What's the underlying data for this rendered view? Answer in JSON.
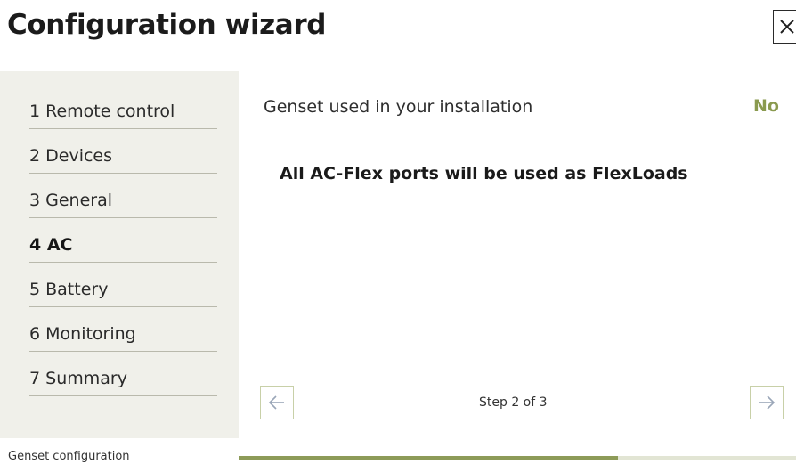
{
  "header": {
    "title": "Configuration wizard",
    "close_icon": "close-icon"
  },
  "sidebar": {
    "items": [
      {
        "label": "1 Remote control",
        "active": false
      },
      {
        "label": "2 Devices",
        "active": false
      },
      {
        "label": "3 General",
        "active": false
      },
      {
        "label": "4 AC",
        "active": true
      },
      {
        "label": "5 Battery",
        "active": false
      },
      {
        "label": "6 Monitoring",
        "active": false
      },
      {
        "label": "7 Summary",
        "active": false
      }
    ]
  },
  "main": {
    "genset_label": "Genset used in your installation",
    "genset_value": "No",
    "info_text": "All AC-Flex ports will be used as FlexLoads",
    "step_text": "Step 2 of 3",
    "prev_icon": "arrow-left-icon",
    "next_icon": "arrow-right-icon"
  },
  "footer": {
    "section_label": "Genset configuration",
    "progress": 0.68
  },
  "colors": {
    "accent": "#8d9b58",
    "panel": "#f0f0ea",
    "value_text": "#8a9a4f"
  }
}
